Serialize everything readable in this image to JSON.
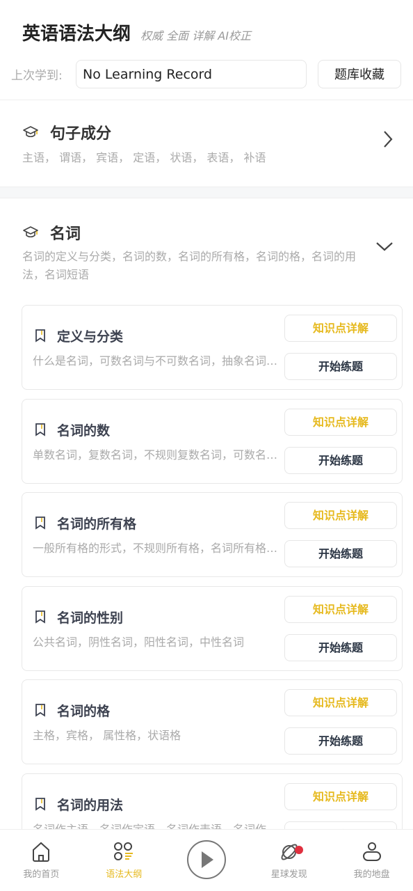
{
  "header": {
    "title": "英语语法大纲",
    "subtitle": "权威 全面 详解 AI校正"
  },
  "record": {
    "label": "上次学到:",
    "value": "No Learning Record",
    "favorites_button": "题库收藏"
  },
  "sections": [
    {
      "title": "句子成分",
      "desc": "主语， 谓语， 宾语， 定语， 状语， 表语， 补语",
      "icon": "graduation-cap-icon",
      "state": "collapsed"
    },
    {
      "title": "名词",
      "desc": "名词的定义与分类，名词的数，名词的所有格，名词的格，名词的用法，名词短语",
      "icon": "graduation-cap-icon",
      "state": "expanded"
    }
  ],
  "topics": [
    {
      "title": "定义与分类",
      "desc": "什么是名词，可数名词与不可数名词，抽象名词，具体名词"
    },
    {
      "title": "名词的数",
      "desc": "单数名词，复数名词，不规则复数名词，可数名词的数"
    },
    {
      "title": "名词的所有格",
      "desc": "一般所有格的形式，不规则所有格，名词所有格的用法"
    },
    {
      "title": "名词的性别",
      "desc": "公共名词，阴性名词，阳性名词，中性名词"
    },
    {
      "title": "名词的格",
      "desc": "主格，宾格， 属性格，状语格"
    },
    {
      "title": "名词的用法",
      "desc": "名词作主语，名词作定语，名词作表语，名词作宾语"
    }
  ],
  "topic_buttons": {
    "detail": "知识点详解",
    "practice": "开始练题"
  },
  "bottom_nav": [
    {
      "label": "我的首页",
      "icon": "home-icon"
    },
    {
      "label": "语法大纲",
      "icon": "outline-grid-icon",
      "active": true
    },
    {
      "label": "",
      "icon": "play-icon"
    },
    {
      "label": "星球发现",
      "icon": "planet-icon",
      "badge": true
    },
    {
      "label": "我的地盘",
      "icon": "user-icon"
    }
  ],
  "colors": {
    "accent": "#e6b91e",
    "badge": "#e0303f"
  }
}
